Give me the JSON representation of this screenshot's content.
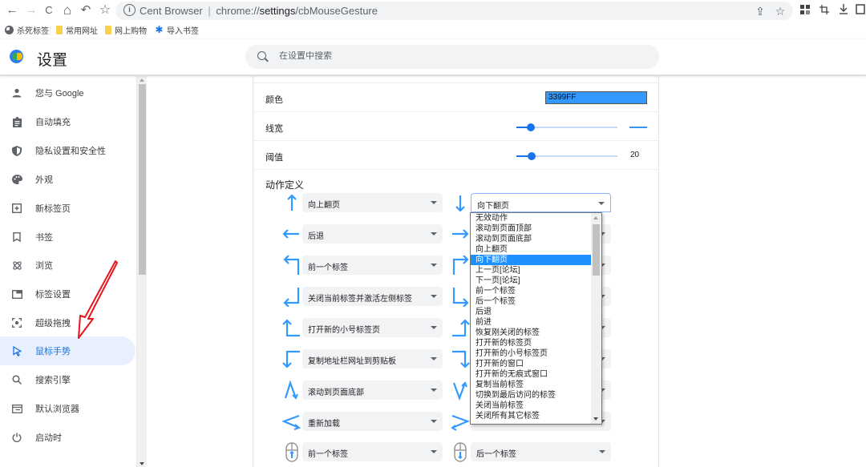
{
  "browser": {
    "nav": {
      "back": "←",
      "forward": "→",
      "reload": "C",
      "home": "⌂",
      "undo": "↶",
      "bookmark_star": "☆"
    },
    "omnibox": {
      "site_name": "Cent Browser",
      "separator": "|",
      "url_scheme": "chrome://",
      "url_host": "settings",
      "url_path": "/cbMouseGesture"
    },
    "bookmarks": [
      {
        "label": "杀死标签",
        "icon": "globe-icon"
      },
      {
        "label": "常用网址",
        "icon": "folder-icon"
      },
      {
        "label": "网上购物",
        "icon": "folder-icon"
      },
      {
        "label": "导入书签",
        "icon": "gear-icon"
      }
    ]
  },
  "header": {
    "title": "设置",
    "search_placeholder": "在设置中搜索"
  },
  "sidebar": {
    "items": [
      {
        "label": "您与 Google",
        "icon": "person-icon",
        "active": false
      },
      {
        "label": "自动填充",
        "icon": "clipboard-icon",
        "active": false
      },
      {
        "label": "隐私设置和安全性",
        "icon": "shield-icon",
        "active": false
      },
      {
        "label": "外观",
        "icon": "palette-icon",
        "active": false
      },
      {
        "label": "新标签页",
        "icon": "new-tab-icon",
        "active": false
      },
      {
        "label": "书签",
        "icon": "bookmark-icon",
        "active": false
      },
      {
        "label": "浏览",
        "icon": "atom-icon",
        "active": false
      },
      {
        "label": "标签设置",
        "icon": "tab-window-icon",
        "active": false
      },
      {
        "label": "超级拖拽",
        "icon": "drag-target-icon",
        "active": false
      },
      {
        "label": "鼠标手势",
        "icon": "cursor-icon",
        "active": true
      },
      {
        "label": "搜索引擎",
        "icon": "search-icon",
        "active": false
      },
      {
        "label": "默认浏览器",
        "icon": "browser-window-icon",
        "active": false
      },
      {
        "label": "启动时",
        "icon": "power-icon",
        "active": false
      }
    ]
  },
  "settings": {
    "color": {
      "label": "颜色",
      "value": "3399FF",
      "swatch": "#3399ff"
    },
    "line_width": {
      "label": "线宽",
      "level_fraction": 0.14
    },
    "threshold": {
      "label": "阈值",
      "value": "20",
      "level_fraction": 0.15
    },
    "actions_title": "动作定义"
  },
  "gestures": {
    "left": [
      {
        "gesture": "up",
        "action": "向上翻页"
      },
      {
        "gesture": "left",
        "action": "后退"
      },
      {
        "gesture": "up-left",
        "action": "前一个标签"
      },
      {
        "gesture": "down-left",
        "action": "关闭当前标签并激活左侧标签"
      },
      {
        "gesture": "left-up",
        "action": "打开新的小号标签页"
      },
      {
        "gesture": "left-down",
        "action": "复制地址栏网址到剪贴板"
      },
      {
        "gesture": "up-down",
        "action": "滚动到页面底部"
      },
      {
        "gesture": "left-right-reversed",
        "action": "重新加载"
      },
      {
        "gesture": "wheel-up",
        "action": "前一个标签"
      }
    ],
    "right": [
      {
        "gesture": "down",
        "action": "向下翻页",
        "open": true
      },
      {
        "gesture": "right",
        "action": ""
      },
      {
        "gesture": "up-right",
        "action": ""
      },
      {
        "gesture": "down-right",
        "action": ""
      },
      {
        "gesture": "right-up",
        "action": ""
      },
      {
        "gesture": "right-down",
        "action": ""
      },
      {
        "gesture": "down-up",
        "action": ""
      },
      {
        "gesture": "right-left-reversed",
        "action": ""
      },
      {
        "gesture": "wheel-down",
        "action": "后一个标签"
      }
    ]
  },
  "dropdown": {
    "selected_index": 4,
    "options": [
      "无效动作",
      "滚动到页面顶部",
      "滚动到页面底部",
      "向上翻页",
      "向下翻页",
      "上一页[论坛]",
      "下一页[论坛]",
      "前一个标签",
      "后一个标签",
      "后退",
      "前进",
      "恢复刚关闭的标签",
      "打开新的标签页",
      "打开新的小号标签页",
      "打开新的窗口",
      "打开新的无痕式窗口",
      "复制当前标签",
      "切换到最后访问的标签",
      "关闭当前标签",
      "关闭所有其它标签"
    ]
  },
  "colors": {
    "accent": "#1a73e8",
    "gesture_arrow": "#3399ff",
    "active_nav_bg": "#e8f0fe",
    "annotation_arrow": "#e8151b"
  }
}
